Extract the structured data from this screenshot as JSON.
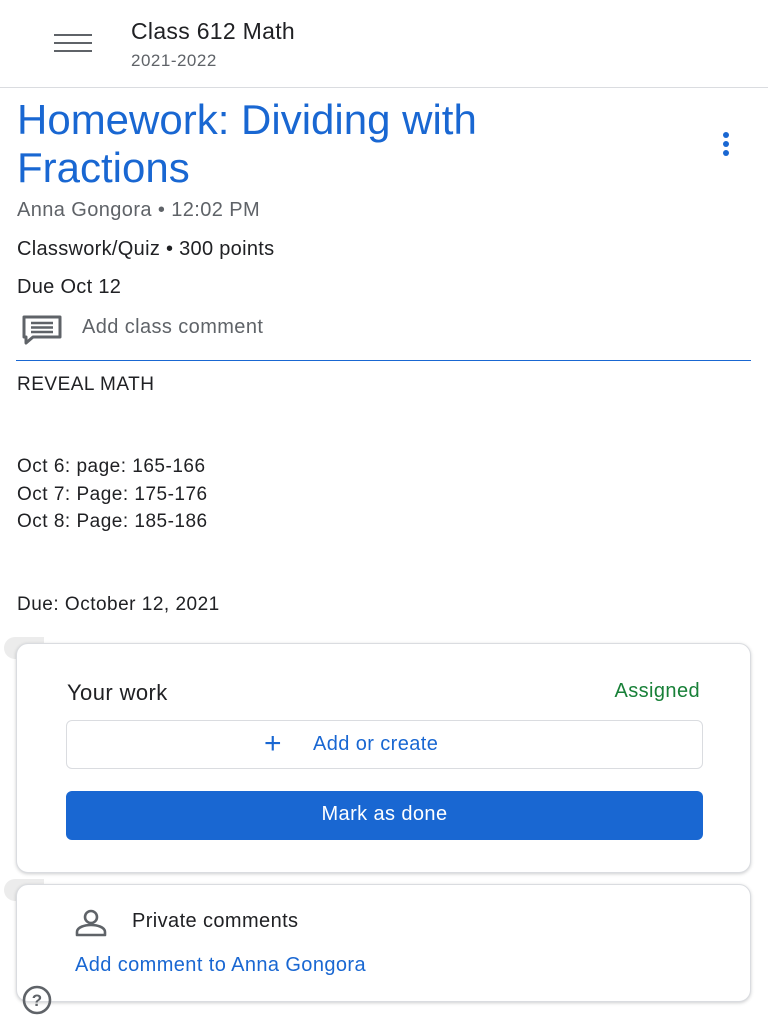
{
  "header": {
    "class_name": "Class 612 Math",
    "school_year": "2021-2022",
    "menu_icon": "menu-icon"
  },
  "assignment": {
    "title": "Homework: Dividing with Fractions",
    "more_icon": "more-vert-icon",
    "author_time": "Anna Gongora • 12:02 PM",
    "type_points": "Classwork/Quiz • 300 points",
    "due": "Due Oct 12",
    "comment_icon": "comment-icon",
    "add_class_comment": "Add class comment"
  },
  "description": {
    "line1": "REVEAL MATH",
    "line2": "Oct 6: page: 165-166",
    "line3": "Oct 7: Page: 175-176",
    "line4": "Oct 8: Page: 185-186",
    "line5": "Due: October 12, 2021"
  },
  "your_work": {
    "title": "Your work",
    "status": "Assigned",
    "status_color": "#188038",
    "add_icon": "plus-icon",
    "add_label": "Add or create",
    "done_label": "Mark as done",
    "accent_color": "#1967d2"
  },
  "private_comments": {
    "icon": "person-icon",
    "title": "Private comments",
    "add_link": "Add comment to Anna Gongora"
  },
  "help": {
    "icon": "help-icon"
  }
}
